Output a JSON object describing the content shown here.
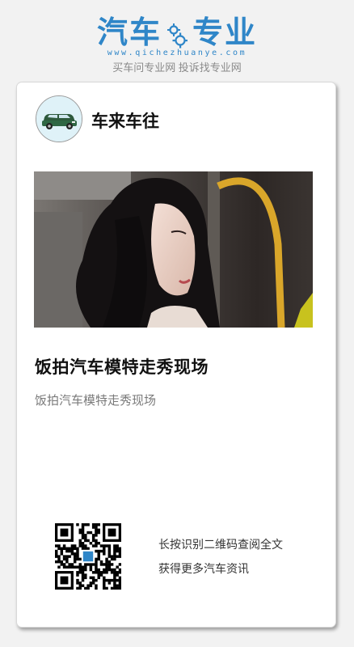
{
  "brand": {
    "title_left": "汽车",
    "title_right": "专业",
    "url": "www.qichezhuanye.com",
    "slogan": "买车问专业网 投诉找专业网",
    "color": "#2f86c8"
  },
  "card": {
    "author_name": "车来车往",
    "avatar_icon": "car-avatar-icon",
    "image_subject": "model-at-car-show-photo",
    "article_title": "饭拍汽车模特走秀现场",
    "article_summary": "饭拍汽车模特走秀现场",
    "qr_icon": "qr-code-icon",
    "qr_line1": "长按识别二维码查阅全文",
    "qr_line2": "获得更多汽车资讯"
  }
}
